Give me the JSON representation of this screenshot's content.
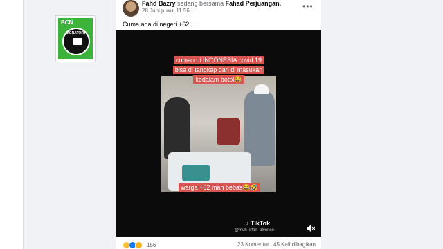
{
  "badge": {
    "brand": "BCN",
    "ring_text": "SIGNATORY"
  },
  "post": {
    "author": "Fahd Bazry",
    "with_text": "sedang bersama",
    "tagged": "Fahad Perjuangan.",
    "timestamp": "28 Juni pukul 11.56",
    "privacy_icon": "globe-icon",
    "more_icon": "ellipsis-icon",
    "body": "Cuma ada di negeri +62....."
  },
  "video": {
    "caption_top": "cuman di INDONESIA covid 19 bisa di tangkap dan di masukan kedalam botol😂",
    "caption_bottom": "warga +62 mah bebas😂🤣",
    "tiktok_label": "TikTok",
    "tiktok_user": "@muh_irfan_alvonso",
    "caption_bg": "#d9534f"
  },
  "footer": {
    "reaction_count": "156",
    "comments": "23 Komentar",
    "shares": "45 Kali dibagikan",
    "reaction_icons": [
      "haha-icon",
      "like-icon",
      "wow-icon"
    ]
  }
}
